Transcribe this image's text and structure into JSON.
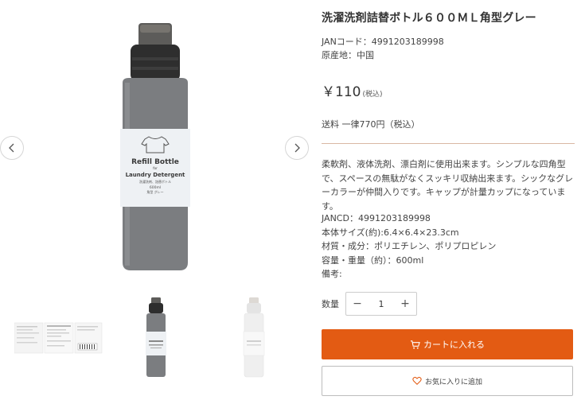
{
  "product": {
    "title": "洗濯洗剤詰替ボトル６００ＭＬ角型グレー",
    "jan_line": "JANコード：4991203189998",
    "origin_line": "原産地：中国",
    "price": "￥110",
    "price_tax": "(税込)",
    "shipping": "送料 一律770円（税込）",
    "description": "柔軟剤、液体洗剤、漂白剤に使用出来ます。シンプルな四角型で、スペースの無駄がなくスッキリ収納出来ます。シックなグレーカラーが仲間入りです。キャップが計量カップになっています。",
    "specs": [
      "JANCD：4991203189998",
      "本体サイズ(約):6.4×6.4×23.3cm",
      "材質・成分：ポリエチレン、ポリプロピレン",
      "容量・重量（約）：600ml",
      "備考:"
    ]
  },
  "bottle_label": {
    "line1": "Refill Bottle",
    "line2": "for",
    "line3": "Laundry Detergent",
    "line4": "洗濯洗剤、詰替ボトル",
    "line5": "600ml",
    "line6": "角型 グレー"
  },
  "purchase": {
    "qty_label": "数量",
    "qty_value": "1",
    "minus": "−",
    "plus": "+",
    "cart_label": "カートに入れる",
    "fav_label": "お気に入りに追加"
  },
  "icons": {
    "prev": "chevron-left-icon",
    "next": "chevron-right-icon",
    "cart": "cart-icon",
    "heart": "heart-icon"
  },
  "colors": {
    "accent": "#e35b13",
    "divider": "#d9b8a3",
    "bottle_gray": "#7b7d80"
  }
}
